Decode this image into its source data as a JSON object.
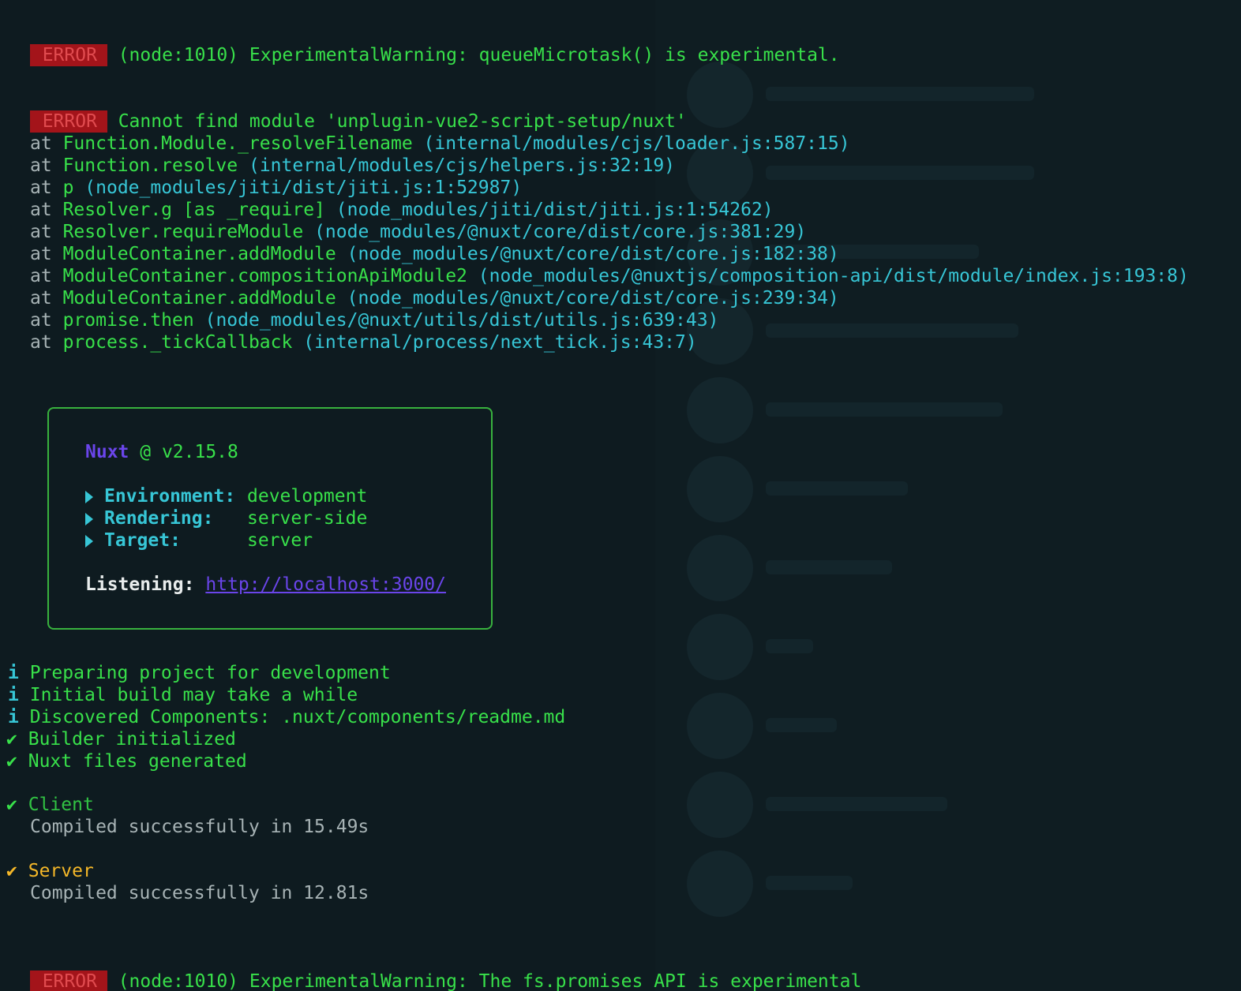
{
  "errors": [
    {
      "badge": "ERROR",
      "text": "(node:1010) ExperimentalWarning: queueMicrotask() is experimental."
    },
    {
      "badge": "ERROR",
      "text": "Cannot find module 'unplugin-vue2-script-setup/nuxt'"
    },
    {
      "badge": "ERROR",
      "text": "(node:1010) ExperimentalWarning: The fs.promises API is experimental"
    }
  ],
  "stack": [
    {
      "at": "at",
      "fn": "Function.Module._resolveFilename",
      "loc": "(internal/modules/cjs/loader.js:587:15)"
    },
    {
      "at": "at",
      "fn": "Function.resolve",
      "loc": "(internal/modules/cjs/helpers.js:32:19)"
    },
    {
      "at": "at",
      "fn": "p",
      "loc": "(node_modules/jiti/dist/jiti.js:1:52987)"
    },
    {
      "at": "at",
      "fn": "Resolver.g [as _require]",
      "loc": "(node_modules/jiti/dist/jiti.js:1:54262)"
    },
    {
      "at": "at",
      "fn": "Resolver.requireModule",
      "loc": "(node_modules/@nuxt/core/dist/core.js:381:29)"
    },
    {
      "at": "at",
      "fn": "ModuleContainer.addModule",
      "loc": "(node_modules/@nuxt/core/dist/core.js:182:38)"
    },
    {
      "at": "at",
      "fn": "ModuleContainer.compositionApiModule2",
      "loc": "(node_modules/@nuxtjs/composition-api/dist/module/index.js:193:8)"
    },
    {
      "at": "at",
      "fn": "ModuleContainer.addModule",
      "loc": "(node_modules/@nuxt/core/dist/core.js:239:34)"
    },
    {
      "at": "at",
      "fn": "promise.then",
      "loc": "(node_modules/@nuxt/utils/dist/utils.js:639:43)"
    },
    {
      "at": "at",
      "fn": "process._tickCallback",
      "loc": "(internal/process/next_tick.js:43:7)"
    }
  ],
  "box": {
    "name": "Nuxt",
    "version": "@ v2.15.8",
    "rows": [
      {
        "key": "Environment:",
        "value": "development"
      },
      {
        "key": "Rendering:",
        "value": "server-side"
      },
      {
        "key": "Target:",
        "value": "server"
      }
    ],
    "listening_label": "Listening:",
    "listening_url": "http://localhost:3000/"
  },
  "info": [
    {
      "icon": "i",
      "text": "Preparing project for development"
    },
    {
      "icon": "i",
      "text": "Initial build may take a while"
    },
    {
      "icon": "i",
      "text": "Discovered Components: .nuxt/components/readme.md"
    }
  ],
  "success": [
    {
      "icon": "✔",
      "text": "Builder initialized"
    },
    {
      "icon": "✔",
      "text": "Nuxt files generated"
    }
  ],
  "client": {
    "icon": "✔",
    "title": "Client",
    "detail": "Compiled successfully in 15.49s"
  },
  "server": {
    "icon": "✔",
    "title": "Server",
    "detail": "Compiled successfully in 12.81s"
  },
  "colors": {
    "green": "#38e04a",
    "cyan": "#37c6d6",
    "error_bg": "#a3141a",
    "orange": "#f4b728",
    "purple": "#6a45ea",
    "background": "#0e1b20"
  }
}
